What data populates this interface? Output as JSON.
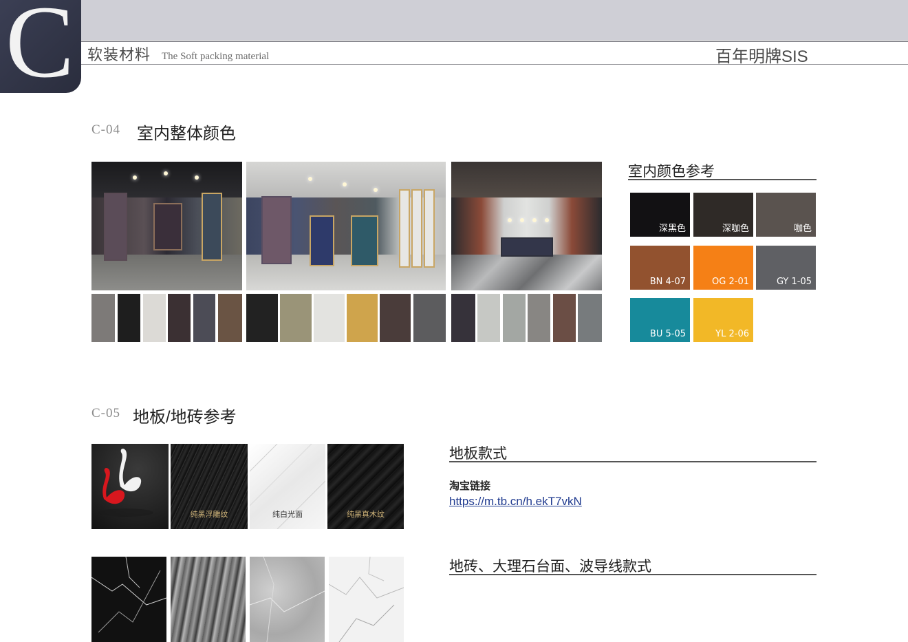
{
  "header": {
    "logo_letter": "C",
    "title_cn": "软装材料",
    "title_en": "The Soft packing material",
    "brand": "百年明牌SIS"
  },
  "section_c04": {
    "code": "C-04",
    "title": "室内整体颜色",
    "palettes": [
      [
        "#7d7a78",
        "#1e1e1e",
        "#dcdad6",
        "#3b3033",
        "#4c4c56",
        "#6a5444"
      ],
      [
        "#222222",
        "#9a9478",
        "#e3e3e0",
        "#cfa44c",
        "#4a3c3a",
        "#5c5c5e"
      ],
      [
        "#36323a",
        "#c6c8c4",
        "#a3a7a3",
        "#888683",
        "#6b4e45",
        "#777b7d"
      ]
    ],
    "reference": {
      "title": "室内颜色参考",
      "chips": [
        {
          "label": "深黑色",
          "color": "#121113"
        },
        {
          "label": "深咖色",
          "color": "#2f2a27"
        },
        {
          "label": "咖色",
          "color": "#5a534f"
        },
        {
          "label": "BN 4-07",
          "color": "#92522f"
        },
        {
          "label": "OG 2-01",
          "color": "#f58016"
        },
        {
          "label": "GY 1-05",
          "color": "#5f6064"
        },
        {
          "label": "BU 5-05",
          "color": "#178a9b"
        },
        {
          "label": "YL 2-06",
          "color": "#f2b827"
        }
      ]
    }
  },
  "section_c05": {
    "code": "C-05",
    "title": "地板/地砖参考",
    "floor_captions": [
      "纯黑浮雕纹",
      "纯白光面",
      "纯黑真木纹"
    ],
    "floor_style_title": "地板款式",
    "taobao_label": "淘宝链接",
    "taobao_url": "https://m.tb.cn/h.ekT7vkN",
    "tile_style_title": "地砖、大理石台面、波导线款式"
  }
}
